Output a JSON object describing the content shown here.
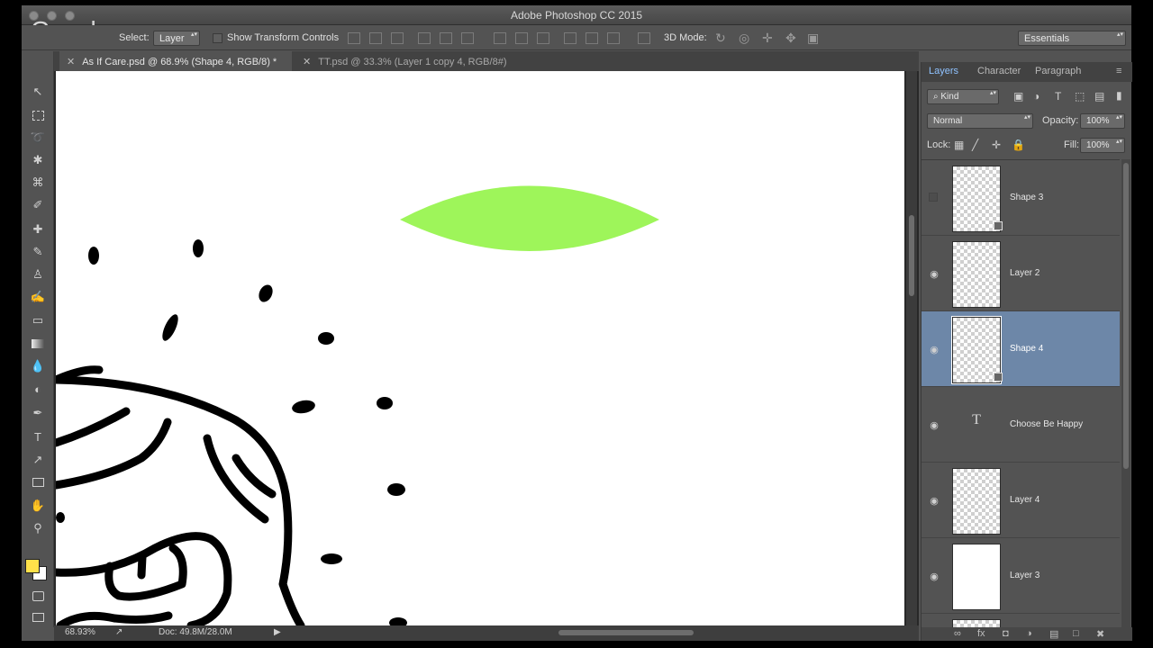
{
  "window": {
    "title": "Adobe Photoshop CC 2015",
    "overlay_logo": "Google"
  },
  "options": {
    "auto_select_label": "Select:",
    "auto_select_value": "Layer",
    "transform_label": "Show Transform Controls",
    "mode_3d_label": "3D Mode:",
    "workspace": "Essentials"
  },
  "tabs": [
    {
      "label": "As If Care.psd @ 68.9% (Shape 4, RGB/8) *",
      "active": true
    },
    {
      "label": "TT.psd @ 33.3% (Layer 1 copy 4, RGB/8#)",
      "active": false
    }
  ],
  "tools": [
    "move-icon",
    "marquee-icon",
    "lasso-icon",
    "magic-wand-icon",
    "crop-icon",
    "eyedropper-icon",
    "healing-brush-icon",
    "brush-icon",
    "clone-stamp-icon",
    "history-brush-icon",
    "eraser-icon",
    "gradient-icon",
    "blur-icon",
    "dodge-icon",
    "pen-icon",
    "type-icon",
    "path-selection-icon",
    "rectangle-icon",
    "hand-icon",
    "zoom-icon"
  ],
  "colors": {
    "foreground": "#ffe14a",
    "background": "#ffffff",
    "leaf": "#9ef55a",
    "selected_layer": "#6d87a8"
  },
  "status": {
    "zoom": "68.93%",
    "doc": "Doc: 49.8M/28.0M"
  },
  "panel": {
    "tabs": [
      "Layers",
      "Character",
      "Paragraph"
    ],
    "filter_label": "Kind",
    "blend_mode": "Normal",
    "opacity_label": "Opacity:",
    "opacity_value": "100%",
    "lock_label": "Lock:",
    "fill_label": "Fill:",
    "fill_value": "100%"
  },
  "layers": [
    {
      "name": "Shape 3",
      "visible": false,
      "kind": "shape",
      "selected": false
    },
    {
      "name": "Layer 2",
      "visible": true,
      "kind": "pixel",
      "selected": false
    },
    {
      "name": "Shape 4",
      "visible": true,
      "kind": "shape",
      "selected": true
    },
    {
      "name": "Choose Be  Happy",
      "visible": true,
      "kind": "text",
      "selected": false
    },
    {
      "name": "Layer 4",
      "visible": true,
      "kind": "pixel",
      "selected": false
    },
    {
      "name": "Layer 3",
      "visible": true,
      "kind": "white",
      "selected": false
    }
  ]
}
